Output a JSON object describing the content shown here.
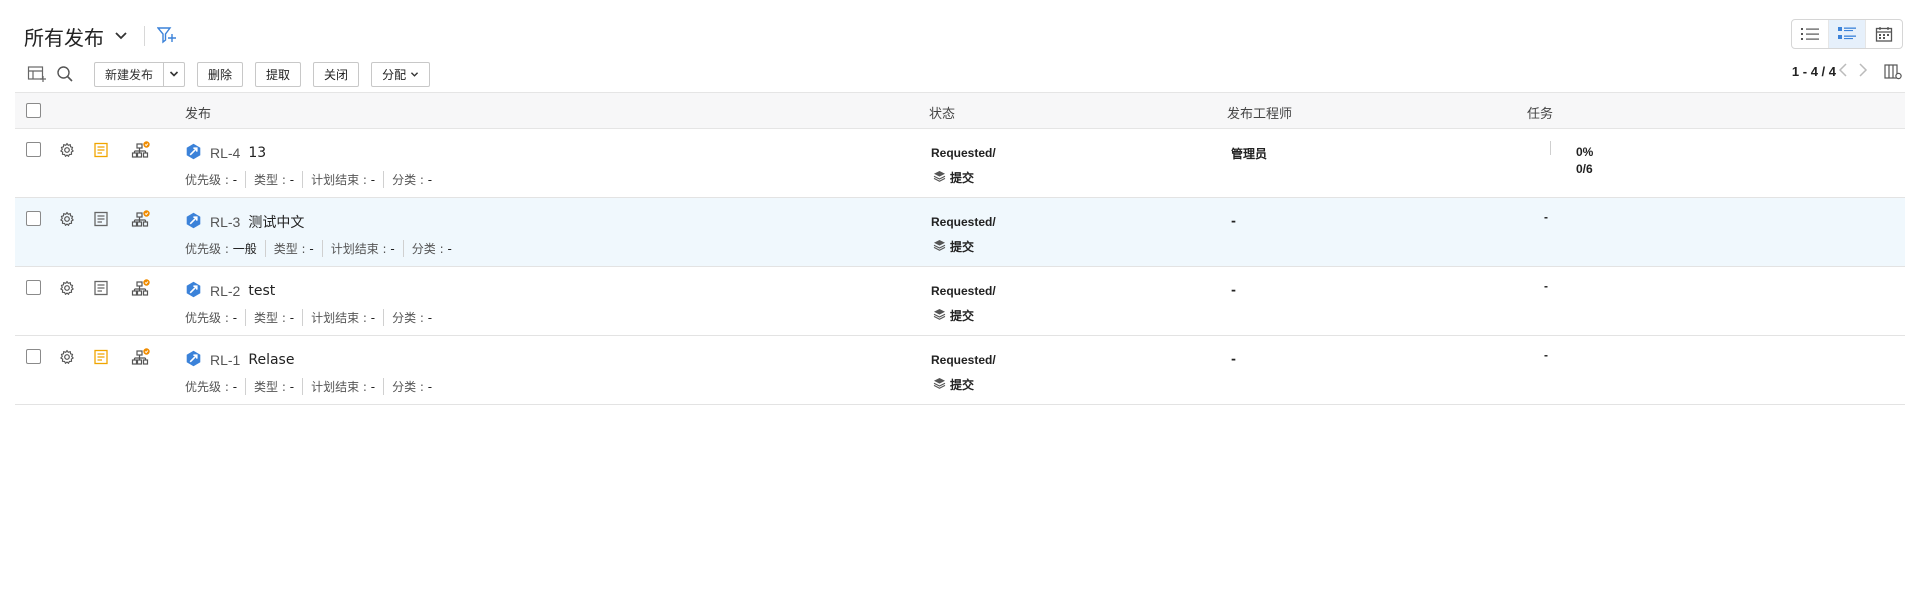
{
  "view": {
    "title": "所有发布"
  },
  "toolbar": {
    "new_label": "新建发布",
    "delete_label": "删除",
    "extract_label": "提取",
    "close_label": "关闭",
    "assign_label": "分配"
  },
  "pager": {
    "range": "1 - 4 / 4"
  },
  "columns": {
    "release": "发布",
    "status": "状态",
    "engineer": "发布工程师",
    "task": "任务"
  },
  "labels": {
    "priority": "优先级 : ",
    "type": "类型 : ",
    "plan_end": "计划结束 : ",
    "category": "分类 : "
  },
  "rows": [
    {
      "key": "RL-4",
      "name": "13",
      "priority": "-",
      "type": "-",
      "plan_end": "-",
      "category": "-",
      "status": "Requested/",
      "stage": "提交",
      "engineer": "管理员",
      "task_pct": "0%",
      "task_count": "0/6",
      "has_note": true
    },
    {
      "key": "RL-3",
      "name": "测试中文",
      "priority": "一般",
      "type": "-",
      "plan_end": "-",
      "category": "-",
      "status": "Requested/",
      "stage": "提交",
      "engineer": "-",
      "task_dash": "-",
      "has_note": false
    },
    {
      "key": "RL-2",
      "name": "test",
      "priority": "-",
      "type": "-",
      "plan_end": "-",
      "category": "-",
      "status": "Requested/",
      "stage": "提交",
      "engineer": "-",
      "task_dash": "-",
      "has_note": false
    },
    {
      "key": "RL-1",
      "name": "Relase",
      "priority": "-",
      "type": "-",
      "plan_end": "-",
      "category": "-",
      "status": "Requested/",
      "stage": "提交",
      "engineer": "-",
      "task_dash": "-",
      "has_note": true
    }
  ],
  "colors": {
    "accent": "#3b82d9",
    "note": "#f0a500",
    "badge": "#f08c00",
    "row_highlight": "#f0f8fd"
  }
}
